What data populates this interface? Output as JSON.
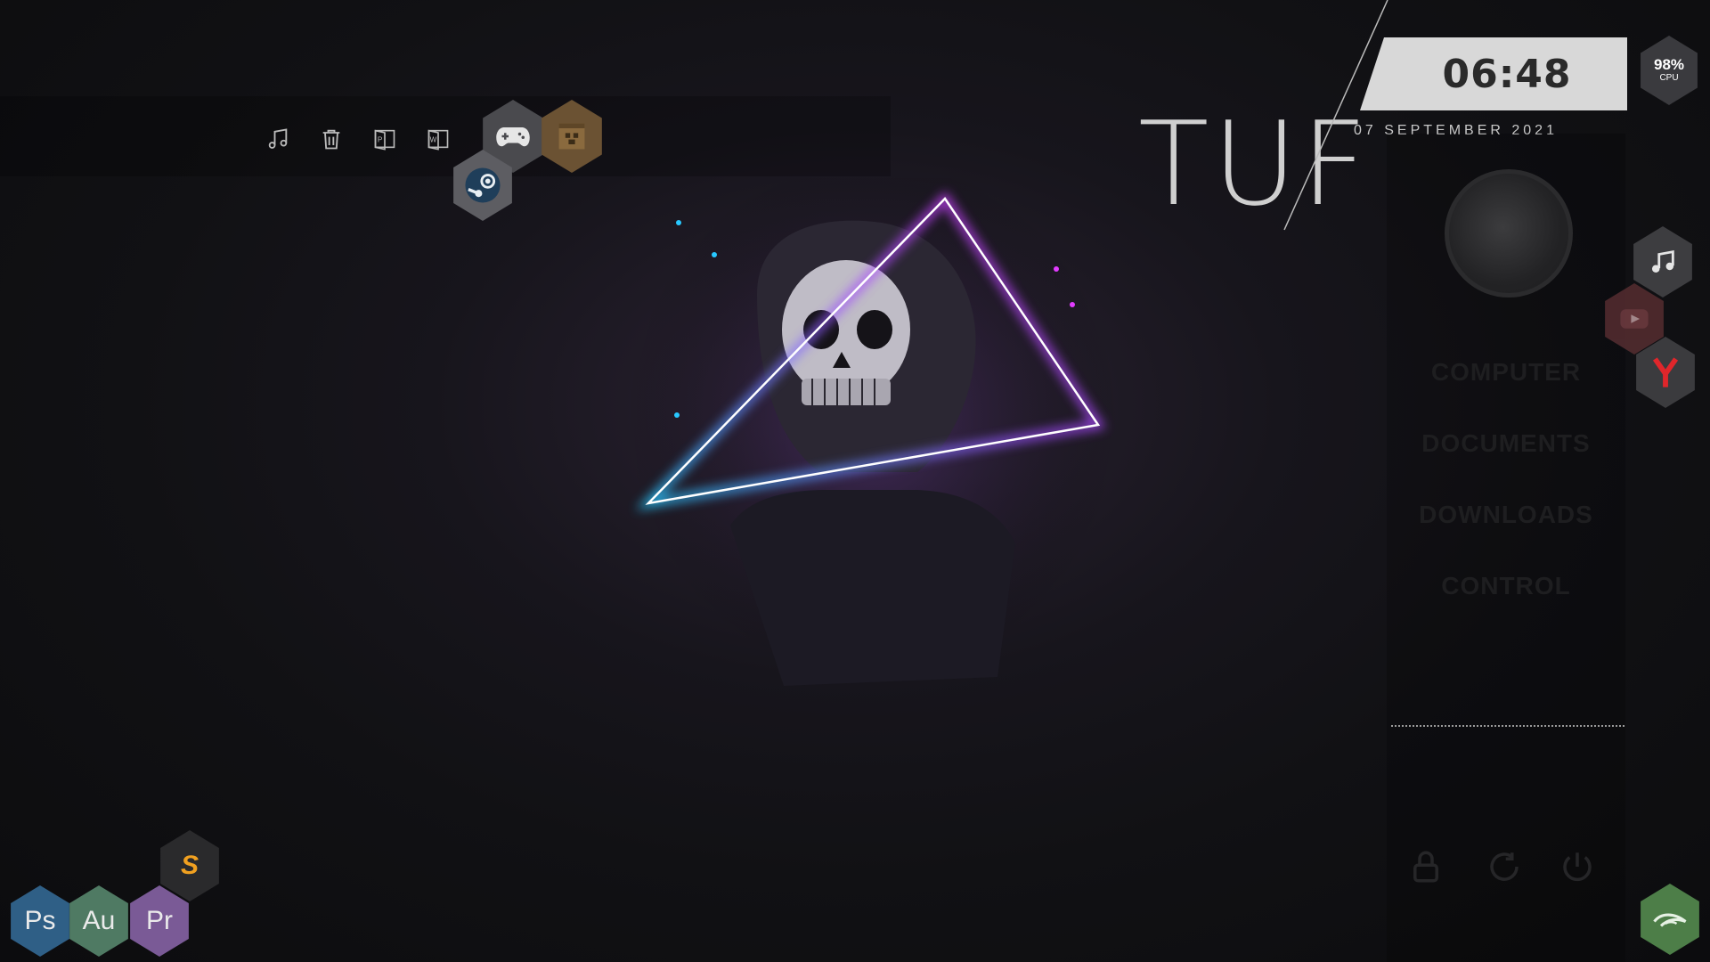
{
  "dock": {
    "icons": [
      "music-note-icon",
      "trash-icon",
      "publisher-icon",
      "word-icon",
      "gamepad-icon",
      "minecraft-icon",
      "steam-icon"
    ]
  },
  "brand": {
    "title": "TUF"
  },
  "clock": {
    "time": "06:48",
    "date": "07 SEPTEMBER 2021"
  },
  "cpu": {
    "value": "98%",
    "label": "CPU"
  },
  "sidebar": {
    "links": [
      {
        "label": "COMPUTER"
      },
      {
        "label": "DOCUMENTS"
      },
      {
        "label": "DOWNLOADS"
      },
      {
        "label": "CONTROL"
      }
    ],
    "actions": [
      "lock-icon",
      "restart-icon",
      "power-icon"
    ]
  },
  "right_dock": [
    "music-note-icon",
    "youtube-icon",
    "yandex-icon",
    "nvidia-icon"
  ],
  "apps": {
    "sublime": {
      "label": "S"
    },
    "photoshop": {
      "label": "Ps",
      "color": "#2f5f86"
    },
    "audition": {
      "label": "Au",
      "color": "#4f7a63"
    },
    "premiere": {
      "label": "Pr",
      "color": "#7a5a96"
    }
  },
  "colors": {
    "neon_blue": "#28c8ff",
    "neon_magenta": "#e23cff",
    "clock_bg": "#d8d8d8"
  }
}
